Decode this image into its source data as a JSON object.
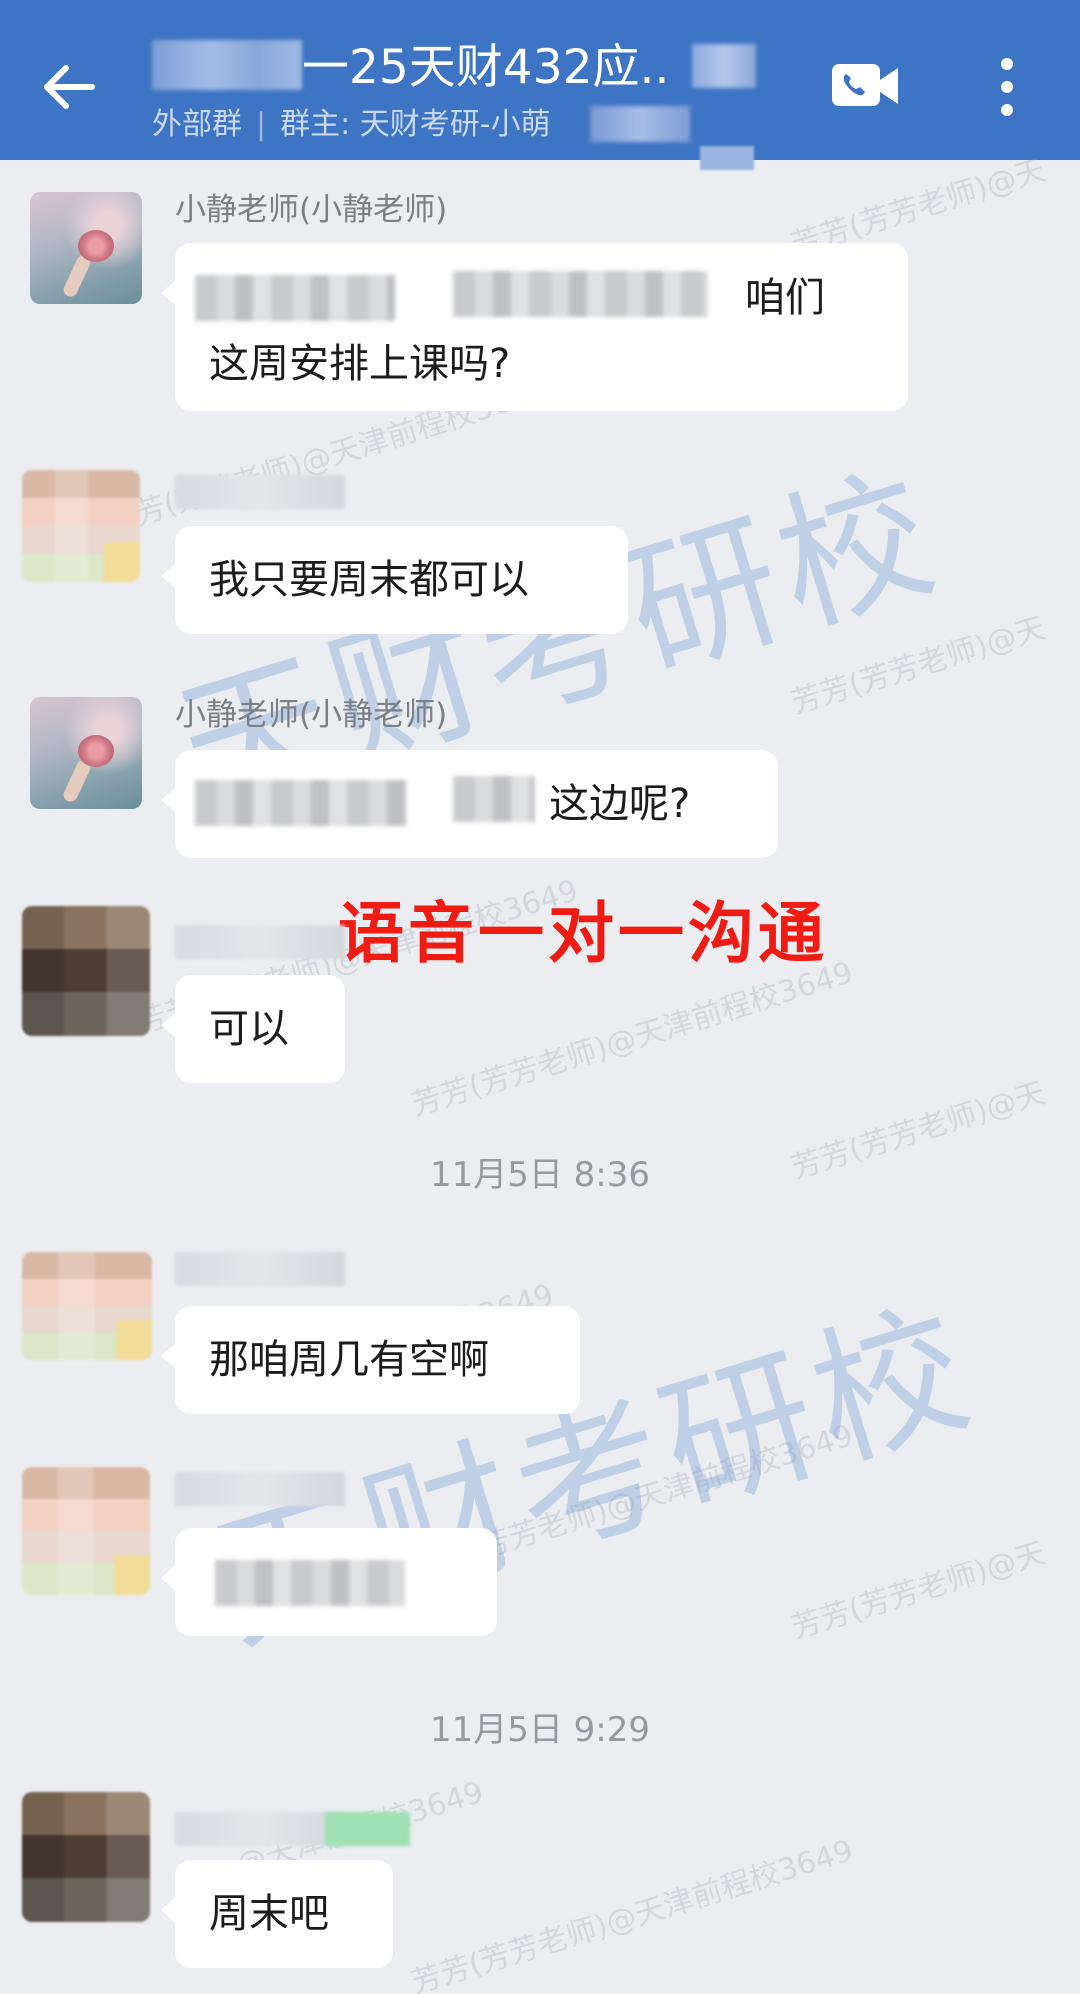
{
  "header": {
    "back_icon": "arrow-left-icon",
    "title": "一25天财432应..",
    "group_type": "外部群",
    "separator": "|",
    "owner": "群主: 天财考研-小萌",
    "video_icon": "video-call-icon",
    "more_icon": "more-vertical-icon"
  },
  "messages": [
    {
      "sender": "小静老师(小静老师)",
      "text_line1": "咱们",
      "text_line2": "这周安排上课吗?"
    },
    {
      "sender": "",
      "text": "我只要周末都可以"
    },
    {
      "sender": "小静老师(小静老师)",
      "text": "这边呢?"
    },
    {
      "sender": "",
      "text": "可以"
    },
    {
      "sender": "",
      "text": "那咱周几有空啊"
    },
    {
      "sender": "",
      "text": ""
    },
    {
      "sender": "",
      "text": "周末吧"
    }
  ],
  "timestamps": [
    "11月5日  8:36",
    "11月5日  9:29"
  ],
  "overlay": {
    "text": "语音一对一沟通",
    "color": "#f01b12"
  },
  "watermark": {
    "brand": "天财考研校",
    "small_1": "芳芳(芳芳老师)@天津前程校3649",
    "small_2": "芳芳(芳芳老师)@天",
    "small_3": "@天津前程校3649"
  },
  "colors": {
    "header": "#3d74c3",
    "background": "#ebedf1",
    "bubble": "#ffffff"
  }
}
